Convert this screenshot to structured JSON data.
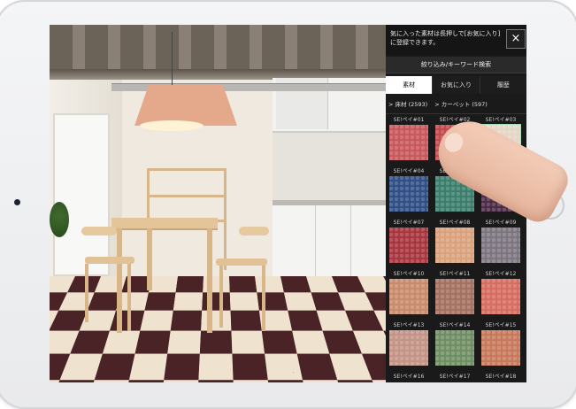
{
  "panel": {
    "notice": "気に入った素材は長押しで[お気に入り]に登録できます。",
    "close_label": "×",
    "filter_label": "絞り込み/キーワード検索",
    "tabs": [
      {
        "label": "素材",
        "active": true
      },
      {
        "label": "お気に入り",
        "active": false
      },
      {
        "label": "履歴",
        "active": false
      }
    ],
    "breadcrumb": [
      "> 床材 (2593)",
      "> カーペット (597)"
    ],
    "swatches": [
      {
        "label": "SE!ペイ#01",
        "color": "#c8575b",
        "selected": false
      },
      {
        "label": "SE!ペイ#02",
        "color": "#c0474e",
        "selected": false
      },
      {
        "label": "SE!ペイ#03",
        "color": "#e3d6c4",
        "selected": true
      },
      {
        "label": "SE!ペイ#04",
        "color": "#2f4e86",
        "selected": false
      },
      {
        "label": "SE!ペイ#05",
        "color": "#3b7d6b",
        "selected": false
      },
      {
        "label": "SE!ペイ#06",
        "color": "#4a2a45",
        "selected": false
      },
      {
        "label": "SE!ペイ#07",
        "color": "#a8343e",
        "selected": false
      },
      {
        "label": "SE!ペイ#08",
        "color": "#d9a17c",
        "selected": false
      },
      {
        "label": "SE!ペイ#09",
        "color": "#7c7580",
        "selected": false
      },
      {
        "label": "SE!ペイ#10",
        "color": "#c98a6c",
        "selected": false
      },
      {
        "label": "SE!ペイ#11",
        "color": "#a36f5f",
        "selected": false
      },
      {
        "label": "SE!ペイ#12",
        "color": "#d66b5f",
        "selected": false
      },
      {
        "label": "SE!ペイ#13",
        "color": "#c39386",
        "selected": false
      },
      {
        "label": "SE!ペイ#14",
        "color": "#6f8d63",
        "selected": false
      },
      {
        "label": "SE!ペイ#15",
        "color": "#c7785a",
        "selected": false
      }
    ],
    "partial_labels": [
      "SE!ペイ#16",
      "SE!ペイ#17",
      "SE!ペイ#18"
    ]
  }
}
